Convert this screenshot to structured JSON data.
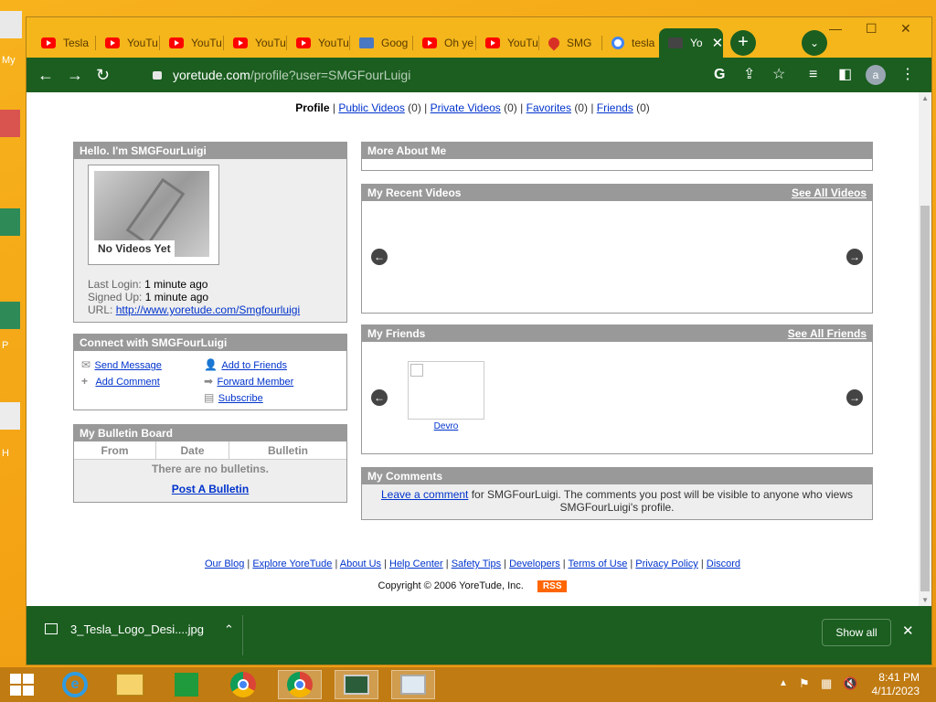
{
  "desktop": {
    "label_top": "My",
    "label_p": "P",
    "label_h": "H"
  },
  "tabs": [
    {
      "label": "Tesla",
      "icon": "youtube-icon"
    },
    {
      "label": "YouTu",
      "icon": "youtube-icon"
    },
    {
      "label": "YouTu",
      "icon": "youtube-icon"
    },
    {
      "label": "YouTu",
      "icon": "youtube-icon"
    },
    {
      "label": "YouTu",
      "icon": "youtube-icon"
    },
    {
      "label": "Goog",
      "icon": "google-docs-icon"
    },
    {
      "label": "Oh ye",
      "icon": "youtube-icon"
    },
    {
      "label": "YouTu",
      "icon": "youtube-icon"
    },
    {
      "label": "SMG",
      "icon": "drop-icon"
    },
    {
      "label": "tesla",
      "icon": "google-icon"
    },
    {
      "label": "Yo",
      "icon": "yoretude-icon"
    }
  ],
  "toolbar": {
    "url_host": "yoretude.com",
    "url_path": "/profile?user=SMGFourLuigi",
    "avatar": "a"
  },
  "nav": {
    "profile": "Profile",
    "public_videos": "Public Videos",
    "public_count": "(0)",
    "private_videos": "Private Videos",
    "private_count": "(0)",
    "favorites": "Favorites",
    "favorites_count": "(0)",
    "friends": "Friends",
    "friends_count": "(0)"
  },
  "profile_box": {
    "title": "Hello. I'm SMGFourLuigi",
    "thumb_caption": "No Videos Yet",
    "last_login_label": "Last Login:",
    "last_login": "1 minute ago",
    "signed_up_label": "Signed Up:",
    "signed_up": "1 minute ago",
    "url_label": "URL:",
    "url": "http://www.yoretude.com/Smgfourluigi"
  },
  "connect_box": {
    "title": "Connect with SMGFourLuigi",
    "send_message": "Send Message",
    "add_comment": "Add Comment",
    "add_friends": "Add to Friends",
    "forward_member": "Forward Member",
    "subscribe": "Subscribe"
  },
  "bulletin_box": {
    "title": "My Bulletin Board",
    "columns": [
      "From",
      "Date",
      "Bulletin"
    ],
    "empty": "There are no bulletins.",
    "post": "Post A Bulletin"
  },
  "more_about": {
    "title": "More About Me"
  },
  "recent_videos": {
    "title": "My Recent Videos",
    "see_all": "See All Videos"
  },
  "friends_box": {
    "title": "My Friends",
    "see_all": "See All Friends",
    "friend_name": "Devro"
  },
  "comments_box": {
    "title": "My Comments",
    "leave": "Leave a comment",
    "text1": " for SMGFourLuigi. The comments you post will be visible to anyone who views",
    "text2": "SMGFourLuigi's profile."
  },
  "footer": {
    "links": [
      "Our Blog",
      "Explore YoreTude",
      "About Us",
      "Help Center",
      "Safety Tips",
      "Developers",
      "Terms of Use",
      "Privacy Policy",
      "Discord"
    ],
    "copyright": "Copyright © 2006 YoreTude, Inc.",
    "rss": "RSS"
  },
  "download": {
    "filename": "3_Tesla_Logo_Desi....jpg",
    "show_all": "Show all"
  },
  "taskbar": {
    "time": "8:41 PM",
    "date": "4/11/2023"
  }
}
